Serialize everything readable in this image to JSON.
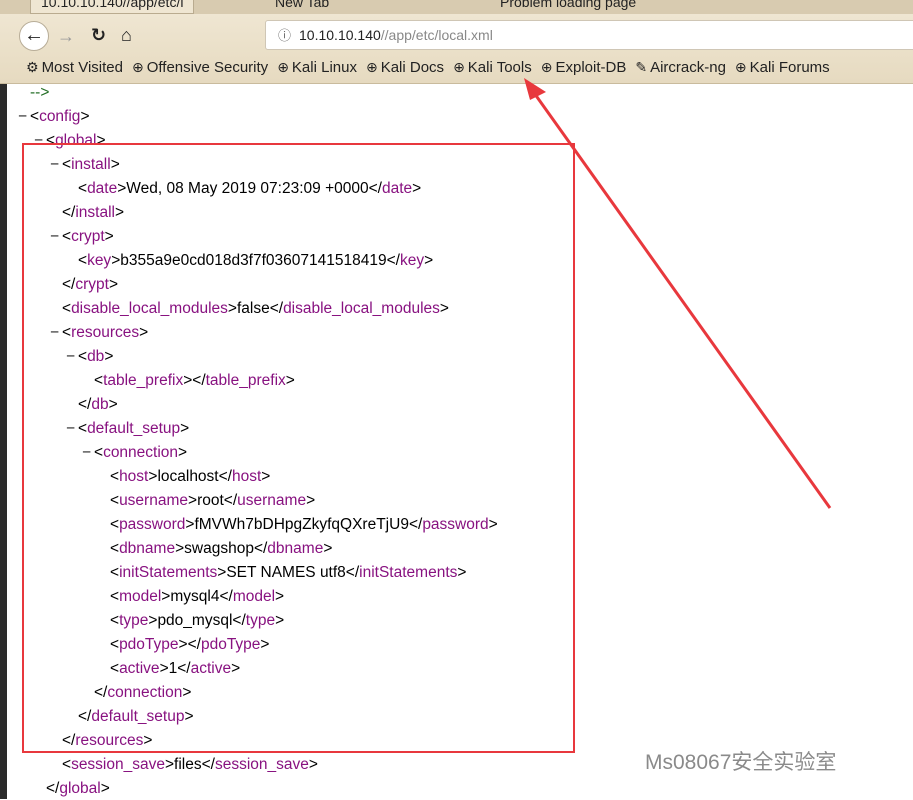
{
  "browser": {
    "tabs": [
      {
        "label": "10.10.10.140//app/etc/l",
        "active": true
      },
      {
        "label": "New Tab",
        "active": false
      },
      {
        "label": "Problem loading page",
        "active": false
      }
    ],
    "url": {
      "host": "10.10.10.140",
      "path": "//app/etc/local.xml"
    },
    "bookmarks": [
      {
        "label": "Most Visited",
        "icon": "gear-icon"
      },
      {
        "label": "Offensive Security",
        "icon": "globe-icon"
      },
      {
        "label": "Kali Linux",
        "icon": "globe-icon"
      },
      {
        "label": "Kali Docs",
        "icon": "globe-icon"
      },
      {
        "label": "Kali Tools",
        "icon": "globe-icon"
      },
      {
        "label": "Exploit-DB",
        "icon": "globe-icon"
      },
      {
        "label": "Aircrack-ng",
        "icon": "feather-icon"
      },
      {
        "label": "Kali Forums",
        "icon": "globe-icon"
      }
    ]
  },
  "colors": {
    "tag": "#881280",
    "comment": "#236e25",
    "highlight_box": "#e8383d"
  },
  "xml": [
    {
      "level": 0,
      "kind": "comment",
      "text": "-->"
    },
    {
      "level": 0,
      "kind": "open",
      "tag": "config",
      "collapsible": true
    },
    {
      "level": 1,
      "kind": "open",
      "tag": "global",
      "collapsible": true
    },
    {
      "level": 2,
      "kind": "open",
      "tag": "install",
      "collapsible": true
    },
    {
      "level": 3,
      "kind": "leaf",
      "tag": "date",
      "text": "Wed, 08 May 2019 07:23:09 +0000"
    },
    {
      "level": 2,
      "kind": "close",
      "tag": "install"
    },
    {
      "level": 2,
      "kind": "open",
      "tag": "crypt",
      "collapsible": true
    },
    {
      "level": 3,
      "kind": "leaf",
      "tag": "key",
      "text": "b355a9e0cd018d3f7f03607141518419"
    },
    {
      "level": 2,
      "kind": "close",
      "tag": "crypt"
    },
    {
      "level": 2,
      "kind": "leaf",
      "tag": "disable_local_modules",
      "text": "false"
    },
    {
      "level": 2,
      "kind": "open",
      "tag": "resources",
      "collapsible": true
    },
    {
      "level": 3,
      "kind": "open",
      "tag": "db",
      "collapsible": true
    },
    {
      "level": 4,
      "kind": "leaf",
      "tag": "table_prefix",
      "text": ""
    },
    {
      "level": 3,
      "kind": "close",
      "tag": "db"
    },
    {
      "level": 3,
      "kind": "open",
      "tag": "default_setup",
      "collapsible": true
    },
    {
      "level": 4,
      "kind": "open",
      "tag": "connection",
      "collapsible": true
    },
    {
      "level": 5,
      "kind": "leaf",
      "tag": "host",
      "text": "localhost"
    },
    {
      "level": 5,
      "kind": "leaf",
      "tag": "username",
      "text": "root"
    },
    {
      "level": 5,
      "kind": "leaf",
      "tag": "password",
      "text": "fMVWh7bDHpgZkyfqQXreTjU9"
    },
    {
      "level": 5,
      "kind": "leaf",
      "tag": "dbname",
      "text": "swagshop"
    },
    {
      "level": 5,
      "kind": "leaf",
      "tag": "initStatements",
      "text": "SET NAMES utf8"
    },
    {
      "level": 5,
      "kind": "leaf",
      "tag": "model",
      "text": "mysql4"
    },
    {
      "level": 5,
      "kind": "leaf",
      "tag": "type",
      "text": "pdo_mysql"
    },
    {
      "level": 5,
      "kind": "leaf",
      "tag": "pdoType",
      "text": ""
    },
    {
      "level": 5,
      "kind": "leaf",
      "tag": "active",
      "text": "1"
    },
    {
      "level": 4,
      "kind": "close",
      "tag": "connection"
    },
    {
      "level": 3,
      "kind": "close",
      "tag": "default_setup"
    },
    {
      "level": 2,
      "kind": "close",
      "tag": "resources"
    },
    {
      "level": 2,
      "kind": "leaf",
      "tag": "session_save",
      "text": "files"
    },
    {
      "level": 1,
      "kind": "close",
      "tag": "global"
    }
  ],
  "watermark": "Ms08067安全实验室"
}
